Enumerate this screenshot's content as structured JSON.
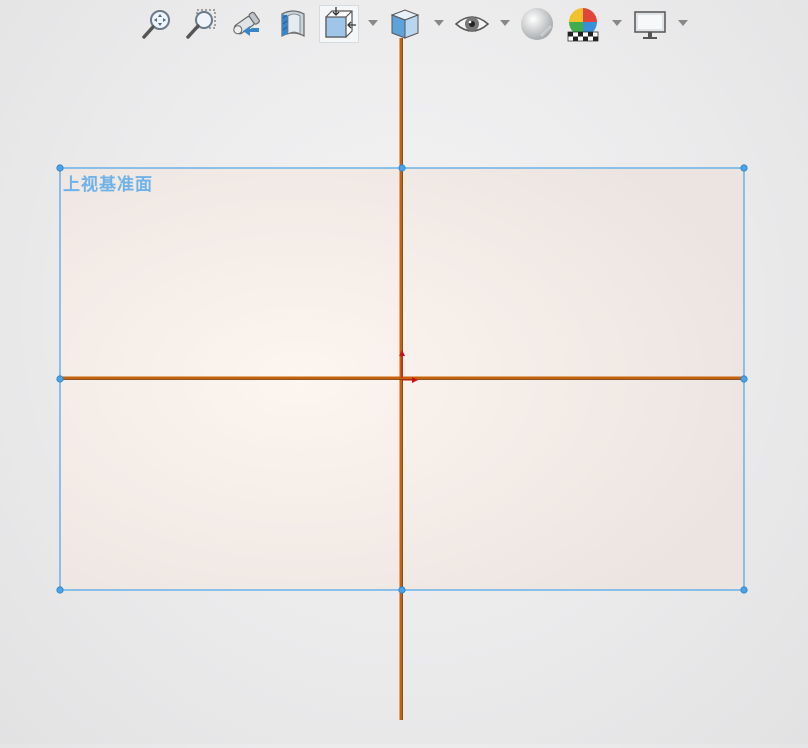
{
  "toolbar": {
    "items": [
      {
        "name": "zoom-to-fit-icon"
      },
      {
        "name": "zoom-to-area-icon"
      },
      {
        "name": "previous-view-icon"
      },
      {
        "name": "section-view-icon"
      },
      {
        "name": "view-orientation-icon",
        "has_dropdown": true
      },
      {
        "name": "display-style-icon",
        "has_dropdown": true
      },
      {
        "name": "hide-show-items-icon",
        "has_dropdown": true
      },
      {
        "name": "edit-appearance-icon"
      },
      {
        "name": "apply-scene-icon",
        "has_dropdown": true
      },
      {
        "name": "view-settings-icon",
        "has_dropdown": true
      }
    ]
  },
  "viewport": {
    "plane_label": "上视基准面",
    "colors": {
      "plane_edge": "#4aa3e8",
      "plane_fill": "#f3e9e2",
      "sketch_axis": "#c8620a",
      "origin": "#d01010",
      "label": "#6fb2ea"
    }
  }
}
